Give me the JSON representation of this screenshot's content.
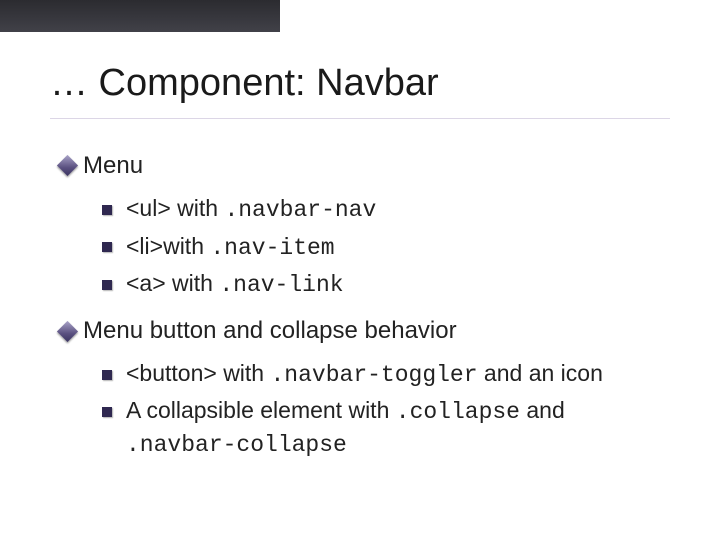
{
  "title": "… Component: Navbar",
  "sections": [
    {
      "heading": "Menu",
      "items": [
        {
          "pre": "<ul> with ",
          "code": ".navbar-nav",
          "post": ""
        },
        {
          "pre": "<li>with ",
          "code": ".nav-item",
          "post": ""
        },
        {
          "pre": "<a> with ",
          "code": ".nav-link",
          "post": ""
        }
      ]
    },
    {
      "heading": "Menu button and collapse behavior",
      "items": [
        {
          "pre": "<button> with ",
          "code": ".navbar-toggler",
          "post": " and an icon"
        },
        {
          "pre": "A collapsible element with ",
          "code": ".collapse",
          "post": " and ",
          "code2": ".navbar-collapse"
        }
      ]
    }
  ]
}
